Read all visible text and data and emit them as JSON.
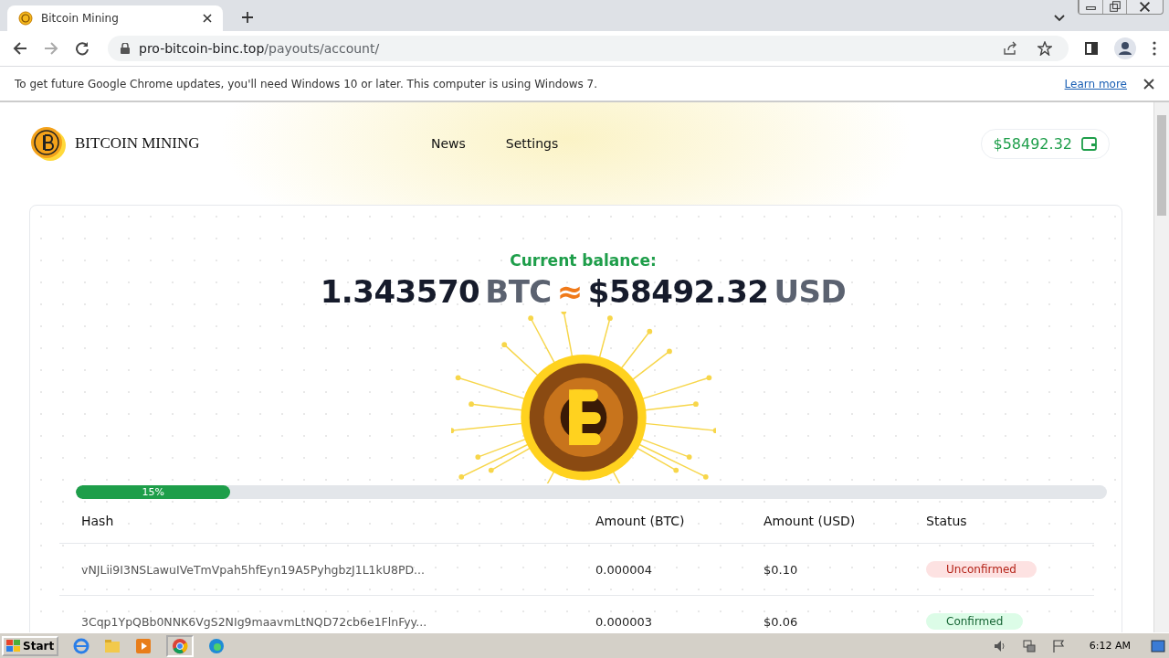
{
  "browser": {
    "tab": {
      "title": "Bitcoin Mining"
    },
    "url": {
      "host": "pro-bitcoin-binc.top",
      "path": "/payouts/account/"
    },
    "infobar": {
      "message": "To get future Google Chrome updates, you'll need Windows 10 or later. This computer is using Windows 7.",
      "link": "Learn more"
    }
  },
  "site": {
    "brand": "BITCOIN MINING",
    "nav": [
      {
        "label": "News"
      },
      {
        "label": "Settings"
      }
    ],
    "wallet": "$58492.32"
  },
  "balance": {
    "label": "Current balance:",
    "btc": "1.343570",
    "btc_unit": "BTC",
    "approx": "≈",
    "usd": "$58492.32",
    "usd_unit": "USD"
  },
  "progress": {
    "level": 0.15,
    "label": "15%"
  },
  "table": {
    "columns": [
      "Hash",
      "Amount (BTC)",
      "Amount (USD)",
      "Status"
    ],
    "rows": [
      {
        "hash": "vNJLii9I3NSLawuIVeTmVpah5hfEyn19A5PyhgbzJ1L1kU8PD...",
        "btc": "0.000004",
        "usd": "$0.10",
        "status": "Unconfirmed",
        "kind": "unconfirmed"
      },
      {
        "hash": "3Cqp1YpQBb0NNK6VgS2NIg9maavmLtNQD72cb6e1FlnFyy...",
        "btc": "0.000003",
        "usd": "$0.06",
        "status": "Confirmed",
        "kind": "confirmed"
      }
    ]
  },
  "taskbar": {
    "start": "Start",
    "clock": "6:12 AM"
  }
}
